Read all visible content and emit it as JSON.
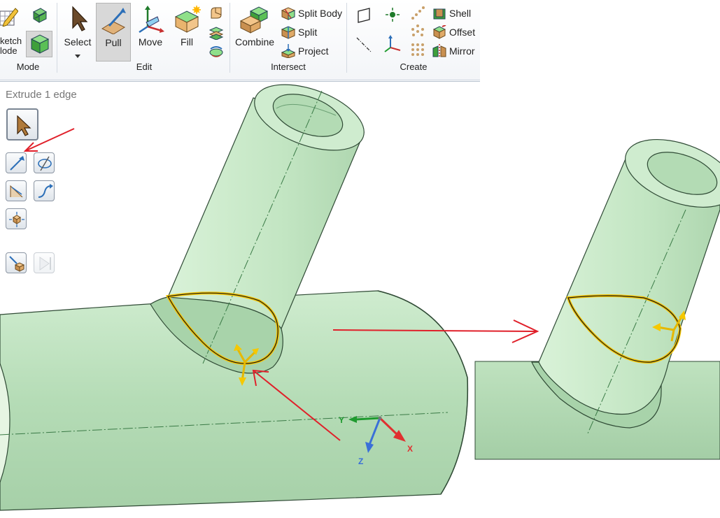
{
  "ribbon": {
    "mode": {
      "sketch_mode_label_line1": "ketch",
      "sketch_mode_label_line2": "lode",
      "group_label": "Mode"
    },
    "edit": {
      "select_label": "Select",
      "pull_label": "Pull",
      "move_label": "Move",
      "fill_label": "Fill",
      "group_label": "Edit"
    },
    "intersect": {
      "combine_label": "Combine",
      "split_body_label": "Split Body",
      "split_label": "Split",
      "project_label": "Project",
      "group_label": "Intersect"
    },
    "create": {
      "shell_label": "Shell",
      "offset_label": "Offset",
      "mirror_label": "Mirror",
      "group_label": "Create"
    }
  },
  "tool_panel": {
    "title": "Extrude 1 edge"
  },
  "viewport": {
    "triad": {
      "x_label": "X",
      "y_label": "Y",
      "z_label": "Z"
    },
    "colors": {
      "body_fill": "#b9dfba",
      "body_fill_light": "#d7f0d6",
      "selected_edge": "#f5c400",
      "annotation_arrow": "#e0202a",
      "axis_x": "#e03030",
      "axis_y": "#1f9a2f",
      "axis_z": "#3a6fd8"
    }
  }
}
